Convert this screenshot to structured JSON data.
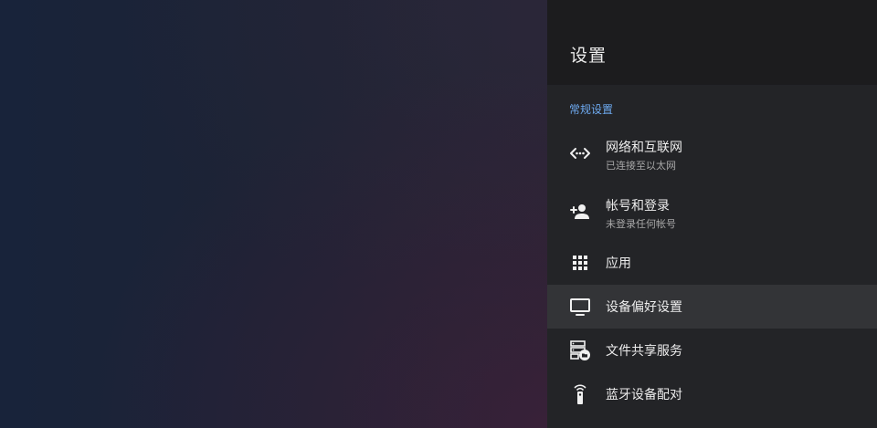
{
  "panel": {
    "title": "设置",
    "section_label": "常规设置",
    "items": [
      {
        "title": "网络和互联网",
        "subtitle": "已连接至以太网",
        "icon": "network-icon"
      },
      {
        "title": "帐号和登录",
        "subtitle": "未登录任何帐号",
        "icon": "add-person-icon"
      },
      {
        "title": "应用",
        "icon": "apps-grid-icon"
      },
      {
        "title": "设备偏好设置",
        "icon": "tv-icon",
        "selected": true
      },
      {
        "title": "文件共享服务",
        "icon": "file-share-icon"
      },
      {
        "title": "蓝牙设备配对",
        "icon": "remote-control-icon"
      }
    ]
  },
  "colors": {
    "panel_bg": "#232427",
    "header_bg": "#1c1c1e",
    "selected_bg": "#333437",
    "accent": "#6eaaf0"
  }
}
